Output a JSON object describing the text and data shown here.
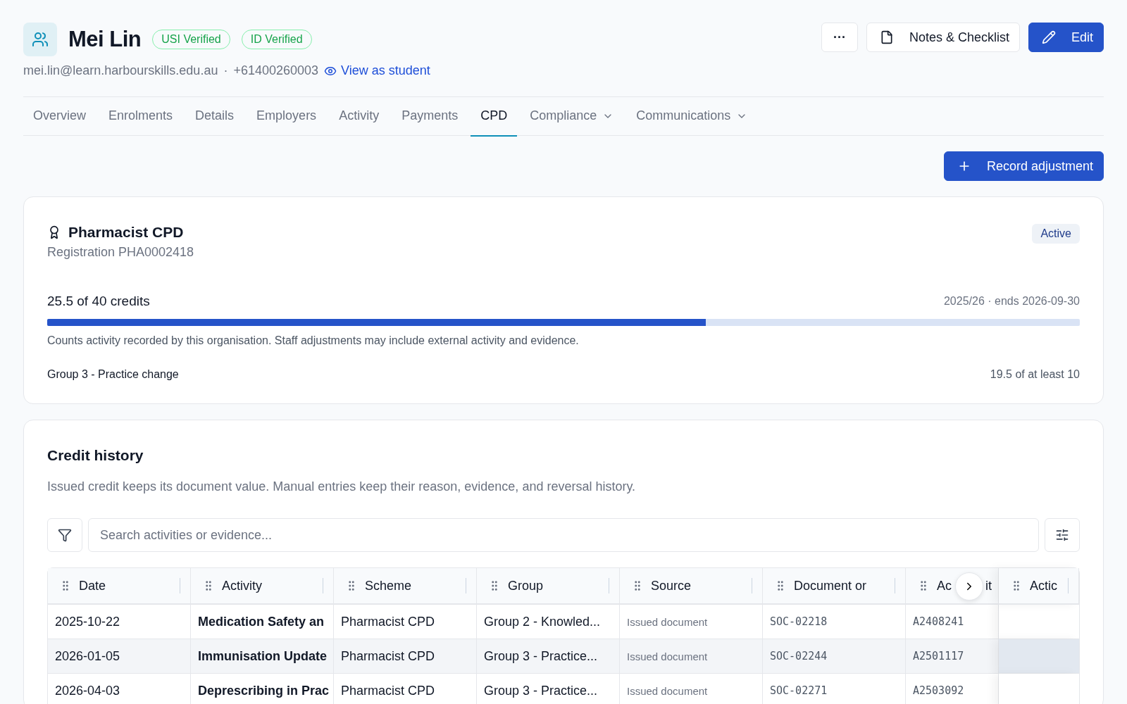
{
  "profile": {
    "name": "Mei Lin",
    "badges": [
      "USI Verified",
      "ID Verified"
    ],
    "email": "mei.lin@learn.harbourskills.edu.au",
    "separator": "·",
    "phone": "+61400260003",
    "view_link": "View as student"
  },
  "actions": [
    {
      "kind": "more",
      "label": "···"
    },
    {
      "kind": "notes",
      "label": "Notes & Checklist"
    },
    {
      "kind": "edit",
      "label": "Edit"
    }
  ],
  "tabs": [
    {
      "label": "Overview",
      "selected": false,
      "dropdown": false
    },
    {
      "label": "Enrolments",
      "selected": false,
      "dropdown": false
    },
    {
      "label": "Details",
      "selected": false,
      "dropdown": false
    },
    {
      "label": "Employers",
      "selected": false,
      "dropdown": false
    },
    {
      "label": "Activity",
      "selected": false,
      "dropdown": false
    },
    {
      "label": "Payments",
      "selected": false,
      "dropdown": false
    },
    {
      "label": "CPD",
      "selected": true,
      "dropdown": false
    },
    {
      "label": "Compliance",
      "selected": false,
      "dropdown": true
    },
    {
      "label": "Communications",
      "selected": false,
      "dropdown": true
    }
  ],
  "record_button": "Record adjustment",
  "cpd_card": {
    "title": "Pharmacist CPD",
    "registration": "Registration PHA0002418",
    "status": "Active",
    "credits": "25.5 of 40 credits",
    "period": "2025/26 · ends 2026-09-30",
    "level": 0.6375,
    "note": "Counts activity recorded by this organisation. Staff adjustments may include external activity and evidence.",
    "group_label": "Group 3 - Practice change",
    "group_value": "19.5 of at least 10"
  },
  "credit_history": {
    "title": "Credit history",
    "description": "Issued credit keeps its document value. Manual entries keep their reason, evidence, and reversal history.",
    "search": {
      "placeholder": "Search activities or evidence..."
    },
    "columns": [
      {
        "label": "Date"
      },
      {
        "label": "Activity"
      },
      {
        "label": "Scheme"
      },
      {
        "label": "Group"
      },
      {
        "label": "Source"
      },
      {
        "label": "Document or"
      },
      {
        "label": "Ac",
        "label_tail": "it"
      },
      {
        "label": "Actic"
      }
    ],
    "rows": [
      {
        "date": "2025-10-22",
        "activity": "Medication Safety an",
        "scheme": "Pharmacist CPD",
        "group": "Group 2 - Knowled...",
        "source": "Issued document",
        "document": "SOC-02218",
        "column_7": "A2408241",
        "selected": false
      },
      {
        "date": "2026-01-05",
        "activity": "Immunisation Update",
        "scheme": "Pharmacist CPD",
        "group": "Group 3 - Practice...",
        "source": "Issued document",
        "document": "SOC-02244",
        "column_7": "A2501117",
        "selected": true
      },
      {
        "date": "2026-04-03",
        "activity": "Deprescribing in Prac",
        "scheme": "Pharmacist CPD",
        "group": "Group 3 - Practice...",
        "source": "Issued document",
        "document": "SOC-02271",
        "column_7": "A2503092",
        "selected": false
      }
    ]
  }
}
